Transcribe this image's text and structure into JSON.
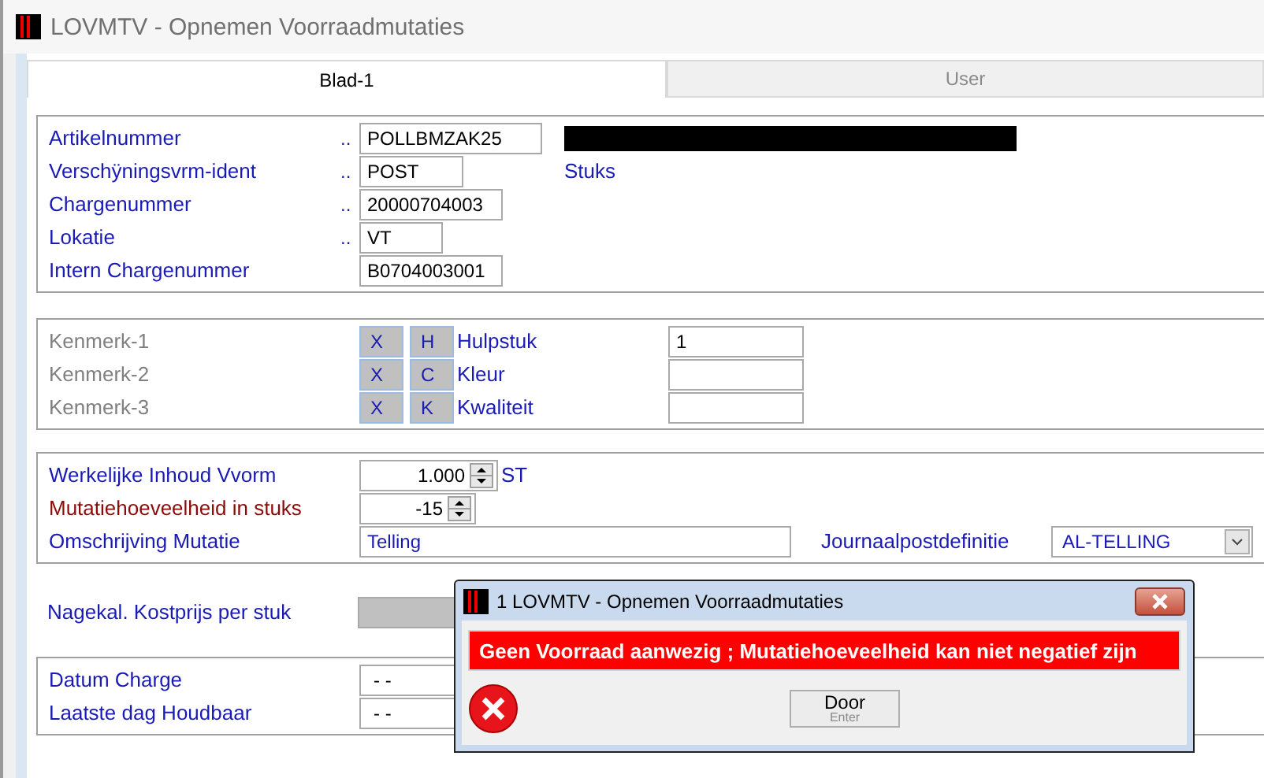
{
  "window": {
    "title": "LOVMTV - Opnemen Voorraadmutaties"
  },
  "tabs": [
    {
      "label": "Blad-1",
      "selected": true
    },
    {
      "label": "User",
      "selected": false
    }
  ],
  "article": {
    "fields": [
      {
        "label": "Artikelnummer",
        "marker": "..",
        "value": "POLLBMZAK25"
      },
      {
        "label": "Verschÿningsvrm-ident",
        "marker": "..",
        "value": "POST"
      },
      {
        "label": "Chargenummer",
        "marker": "..",
        "value": "20000704003"
      },
      {
        "label": "Lokatie",
        "marker": "..",
        "value": "VT"
      },
      {
        "label": "Intern Chargenummer",
        "value": "B0704003001"
      }
    ],
    "unit": "Stuks"
  },
  "characteristics": [
    {
      "label": "Kenmerk-1",
      "code_1": "X",
      "code_2": "H",
      "name": "Hulpstuk",
      "value": "1"
    },
    {
      "label": "Kenmerk-2",
      "code_1": "X",
      "code_2": "C",
      "name": "Kleur"
    },
    {
      "label": "Kenmerk-3",
      "code_1": "X",
      "code_2": "K",
      "name": "Kwaliteit"
    }
  ],
  "quantities": [
    {
      "label": "Werkelijke Inhoud Vvorm",
      "value": "1.000",
      "unit": "ST",
      "highlighted": false
    },
    {
      "label": "Mutatiehoeveelheid in stuks",
      "value": "-15",
      "highlighted": true
    }
  ],
  "description": {
    "label": "Omschrijving Mutatie",
    "value": "Telling"
  },
  "journal": {
    "label": "Journaalpostdefinitie",
    "value": "AL-TELLING"
  },
  "cost": {
    "label": "Nagekal. Kostprijs per stuk"
  },
  "dates": [
    {
      "label": "Datum Charge",
      "value": "- -"
    },
    {
      "label": "Laatste dag Houdbaar",
      "value": "- -"
    }
  ],
  "dialog": {
    "title": "1 LOVMTV - Opnemen Voorraadmutaties",
    "message": "Geen Voorraad aanwezig ; Mutatiehoeveelheid kan niet negatief zijn",
    "button": {
      "label": "Door",
      "shortcut": "Enter"
    }
  }
}
